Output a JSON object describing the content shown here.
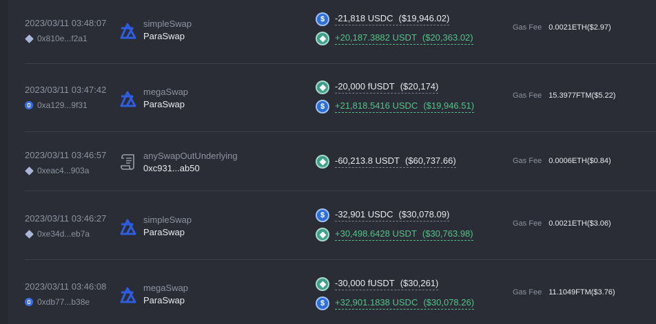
{
  "colors": {
    "background": "#2a2d36",
    "divider": "#3c404b",
    "muted_text": "#8d93a0",
    "positive": "#55c289",
    "paraswap_blue": "#2f5de0"
  },
  "gas_label": "Gas Fee",
  "rows": [
    {
      "time": "2023/03/11 03:48:07",
      "chain_icon": "eth",
      "address": "0x810e...f2a1",
      "method": "simpleSwap",
      "protocol": "ParaSwap",
      "protocol_icon": "paraswap-icon",
      "tokens": [
        {
          "icon": "usdc",
          "amount": "-21,818 USDC",
          "usd": "($19,946.02)",
          "positive": false
        },
        {
          "icon": "usdt",
          "amount": "+20,187.3882 USDT",
          "usd": "($20,363.02)",
          "positive": true
        }
      ],
      "gas": "0.0021ETH($2.97)"
    },
    {
      "time": "2023/03/11 03:47:42",
      "chain_icon": "ftm",
      "address": "0xa129...9f31",
      "method": "megaSwap",
      "protocol": "ParaSwap",
      "protocol_icon": "paraswap-icon",
      "tokens": [
        {
          "icon": "usdt",
          "amount": "-20,000 fUSDT",
          "usd": "($20,174)",
          "positive": false
        },
        {
          "icon": "usdc",
          "amount": "+21,818.5416 USDC",
          "usd": "($19,946.51)",
          "positive": true
        }
      ],
      "gas": "15.3977FTM($5.22)"
    },
    {
      "time": "2023/03/11 03:46:57",
      "chain_icon": "eth",
      "address": "0xeac4...903a",
      "method": "anySwapOutUnderlying",
      "protocol": "0xc931...ab50",
      "protocol_icon": "contract-scroll-icon",
      "tokens": [
        {
          "icon": "usdt",
          "amount": "-60,213.8 USDT",
          "usd": "($60,737.66)",
          "positive": false
        }
      ],
      "gas": "0.0006ETH($0.84)"
    },
    {
      "time": "2023/03/11 03:46:27",
      "chain_icon": "eth",
      "address": "0xe34d...eb7a",
      "method": "simpleSwap",
      "protocol": "ParaSwap",
      "protocol_icon": "paraswap-icon",
      "tokens": [
        {
          "icon": "usdc",
          "amount": "-32,901 USDC",
          "usd": "($30,078.09)",
          "positive": false
        },
        {
          "icon": "usdt",
          "amount": "+30,498.6428 USDT",
          "usd": "($30,763.98)",
          "positive": true
        }
      ],
      "gas": "0.0021ETH($3.06)"
    },
    {
      "time": "2023/03/11 03:46:08",
      "chain_icon": "ftm",
      "address": "0xdb77...b38e",
      "method": "megaSwap",
      "protocol": "ParaSwap",
      "protocol_icon": "paraswap-icon",
      "tokens": [
        {
          "icon": "usdt",
          "amount": "-30,000 fUSDT",
          "usd": "($30,261)",
          "positive": false
        },
        {
          "icon": "usdc",
          "amount": "+32,901.1838 USDC",
          "usd": "($30,078.26)",
          "positive": true
        }
      ],
      "gas": "11.1049FTM($3.76)"
    }
  ]
}
